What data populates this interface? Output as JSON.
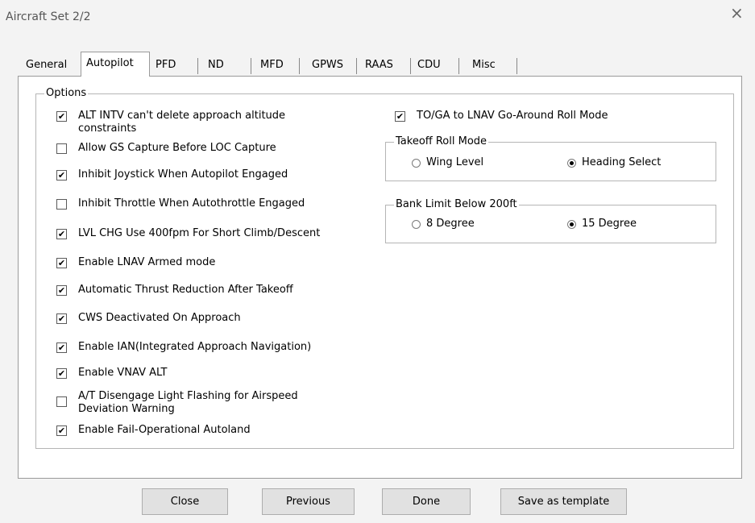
{
  "window": {
    "title": "Aircraft Set 2/2",
    "close_glyph": "×"
  },
  "tabs": [
    {
      "label": "General"
    },
    {
      "label": "Autopilot",
      "active": true
    },
    {
      "label": "PFD"
    },
    {
      "label": "ND"
    },
    {
      "label": "MFD"
    },
    {
      "label": "GPWS"
    },
    {
      "label": "RAAS"
    },
    {
      "label": "CDU"
    },
    {
      "label": "Misc"
    }
  ],
  "options_group": {
    "label": "Options",
    "items": [
      {
        "line1": "ALT INTV can't delete approach altitude",
        "line2": "constraints",
        "checked": true
      },
      {
        "line1": "Allow GS Capture Before LOC Capture",
        "line2": "",
        "checked": false
      },
      {
        "line1": "Inhibit Joystick When Autopilot Engaged",
        "line2": "",
        "checked": true
      },
      {
        "line1": "Inhibit Throttle When Autothrottle Engaged",
        "line2": "",
        "checked": false
      },
      {
        "line1": "LVL CHG Use 400fpm For Short Climb/Descent",
        "line2": "",
        "checked": true
      },
      {
        "line1": "Enable LNAV Armed mode",
        "line2": "",
        "checked": true
      },
      {
        "line1": "Automatic Thrust Reduction After Takeoff",
        "line2": "",
        "checked": true
      },
      {
        "line1": "CWS Deactivated On Approach",
        "line2": "",
        "checked": true
      },
      {
        "line1": "Enable IAN(Integrated Approach Navigation)",
        "line2": "",
        "checked": true
      },
      {
        "line1": "Enable VNAV ALT",
        "line2": "",
        "checked": true
      },
      {
        "line1": "A/T Disengage Light Flashing for Airspeed",
        "line2": "Deviation Warning",
        "checked": false
      },
      {
        "line1": "Enable Fail-Operational Autoland",
        "line2": "",
        "checked": true
      }
    ],
    "toga": {
      "label": "TO/GA to LNAV Go-Around Roll Mode",
      "checked": true
    }
  },
  "takeoff_roll": {
    "label": "Takeoff Roll Mode",
    "options": [
      {
        "label": "Wing Level",
        "selected": false
      },
      {
        "label": "Heading Select",
        "selected": true
      }
    ]
  },
  "bank_limit": {
    "label": "Bank Limit Below 200ft",
    "options": [
      {
        "label": "8 Degree",
        "selected": false
      },
      {
        "label": "15 Degree",
        "selected": true
      }
    ]
  },
  "buttons": {
    "close": "Close",
    "previous": "Previous",
    "done": "Done",
    "save_template": "Save as template"
  },
  "check_glyph": "✔"
}
